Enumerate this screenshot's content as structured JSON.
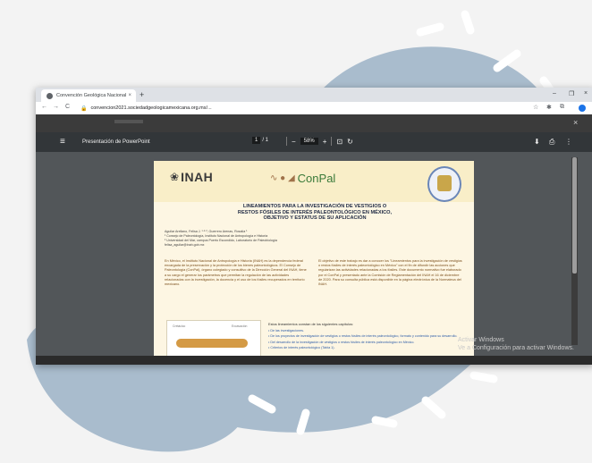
{
  "browser": {
    "tab_title": "Convención Geológica Nacional",
    "tab_close": "×",
    "new_tab": "+",
    "url": "convencion2021.sociedadgeologicamexicana.org.mx/...",
    "lock_icon": "lock-icon",
    "back": "←",
    "forward": "→",
    "reload": "C",
    "minimize": "–",
    "maximize": "❐",
    "close": "×"
  },
  "overlay": {
    "close": "×"
  },
  "pdf_viewer": {
    "menu": "≡",
    "document_title": "Presentación de PowerPoint",
    "page_current": "1",
    "page_total": "/ 1",
    "zoom_out": "−",
    "zoom": "58%",
    "zoom_in": "+",
    "download": "⬇",
    "print": "⎙",
    "more": "⋮"
  },
  "poster": {
    "logo_left": "INAH",
    "logo_right": "ConPal",
    "title_line1": "LINEAMIENTOS PARA LA INVESTIGACIÓN DE VESTIGIOS O",
    "title_line2": "RESTOS FÓSILES DE INTERÉS PALEONTOLÓGICO EN MÉXICO,",
    "title_line3": "OBJETIVO Y ESTATUS DE SU APLICACIÓN",
    "authors": "Aguilar Arellano, Felisa J. ¹·²·³, Guerrero Arenas, Rosalía ¹",
    "affil_1": "¹ Consejo de Paleontología, Instituto Nacional de Antropología e Historia",
    "affil_2": "² Universidad del Mar, campus Puerto Escondido, Laboratorio de Paleobiología",
    "email": "felisa_aguilar@inah.gob.mx",
    "left_col": "En México, el Instituto Nacional de Antropología e Historia (INAH) es la dependencia federal encargada de la preservación y la protección de los bienes paleontológicos. El Consejo de Paleontología (ConPal), órgano colegiado y consultivo de la Dirección General del INAH, tiene a su cargo el generar los parámetros que permitan la regulación de las actividades relacionadas con la investigación, la docencia y el uso de los fósiles recuperados en territorio mexicano.",
    "right_col": "El objetivo de este trabajo es dar a conocer los \"Lineamientos para la investigación de vestigios o restos fósiles de interés paleontológico en México\" con el fin de difundir las acciones que regularizan las actividades relacionadas a los fósiles. Este documento normativo fue elaborado por el ConPal y presentado ante la Comisión de Reglamentación del INAH el 16 de diciembre de 2020. Para su consulta pública está disponible en la página electrónica de la Normateca del INAH.",
    "fig_label_1": "Cretácico",
    "fig_label_2": "Excavación",
    "objectives_head": "Estos lineamientos constan de los siguientes capítulos:",
    "objectives": [
      "De las investigaciones.",
      "De los proyectos de investigación de vestigios o restos fósiles de interés paleontológico, formato y contenido para su desarrollo.",
      "Del desarrollo de la investigación de vestigios o restos fósiles de interés paleontológico en México.",
      "Criterios de interés paleontológico (Tabla 1)."
    ]
  },
  "watermark": {
    "line1": "Activar Windows",
    "line2": "Ve a Configuración para activar Windows."
  },
  "colors": {
    "blob": "#a9bccd",
    "viewer_bg": "#525659",
    "pdf_toolbar": "#323639",
    "poster_bg": "#fdf6e3"
  }
}
